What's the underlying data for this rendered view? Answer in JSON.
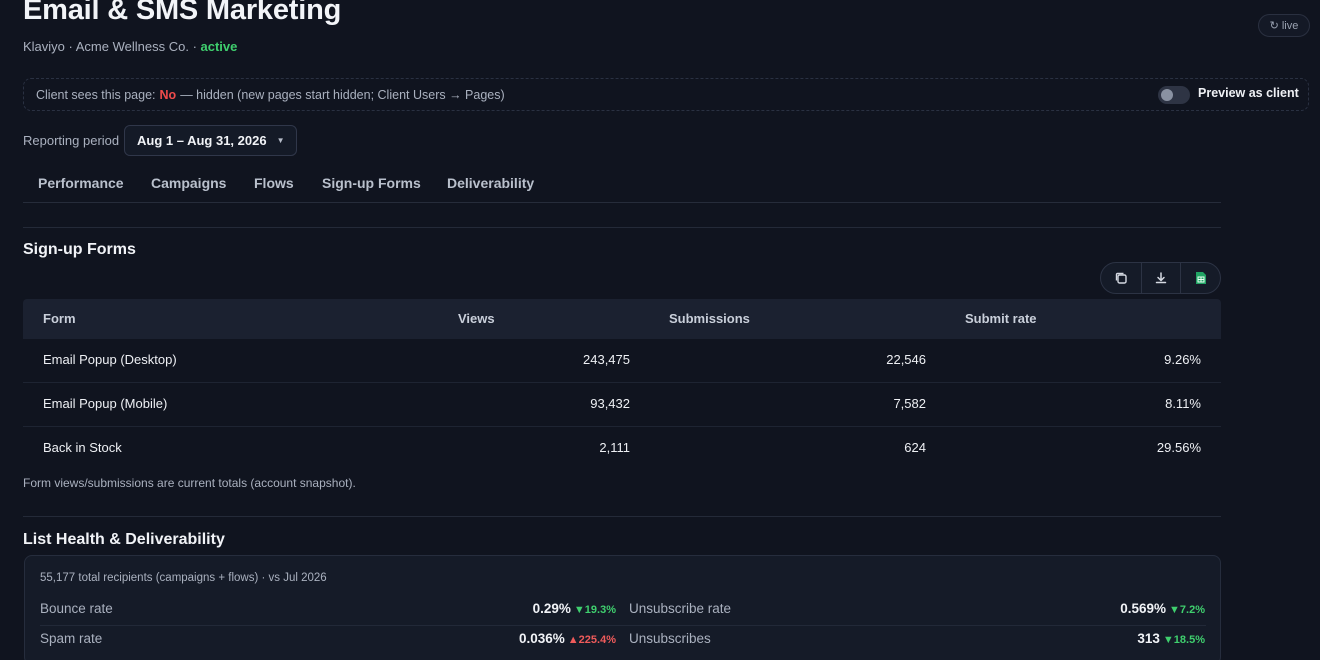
{
  "header": {
    "title": "Email & SMS Marketing",
    "platform": "Klaviyo",
    "client": "Acme Wellness Co.",
    "status": "active",
    "live_label": "live"
  },
  "visibility": {
    "prefix": "Client sees this page:",
    "value": "No",
    "suffix": "— hidden (new pages start hidden; Client Users → Pages)",
    "preview_label": "Preview as client"
  },
  "reporting": {
    "label": "Reporting period",
    "value": "Aug 1 – Aug 31, 2026"
  },
  "tabs": [
    {
      "label": "Performance"
    },
    {
      "label": "Campaigns"
    },
    {
      "label": "Flows"
    },
    {
      "label": "Sign-up Forms"
    },
    {
      "label": "Deliverability"
    }
  ],
  "signup_forms": {
    "title": "Sign-up Forms",
    "columns": [
      "Form",
      "Views",
      "Submissions",
      "Submit rate"
    ],
    "rows": [
      {
        "form": "Email Popup (Desktop)",
        "views": "243,475",
        "submissions": "22,546",
        "rate": "9.26%"
      },
      {
        "form": "Email Popup (Mobile)",
        "views": "93,432",
        "submissions": "7,582",
        "rate": "8.11%"
      },
      {
        "form": "Back in Stock",
        "views": "2,111",
        "submissions": "624",
        "rate": "29.56%"
      }
    ],
    "footnote": "Form views/submissions are current totals (account snapshot).",
    "icons": [
      "copy-icon",
      "download-icon",
      "spreadsheet-icon"
    ]
  },
  "list_health": {
    "title": "List Health & Deliverability",
    "note": "55,177 total recipients (campaigns + flows) · vs Jul 2026",
    "metrics": [
      {
        "label": "Bounce rate",
        "value": "0.29%",
        "delta": "▼19.3%",
        "direction": "down"
      },
      {
        "label": "Unsubscribe rate",
        "value": "0.569%",
        "delta": "▼7.2%",
        "direction": "down"
      },
      {
        "label": "Spam rate",
        "value": "0.036%",
        "delta": "▲225.4%",
        "direction": "up"
      },
      {
        "label": "Unsubscribes",
        "value": "313",
        "delta": "▼18.5%",
        "direction": "down"
      }
    ]
  },
  "colors": {
    "background": "#10141f",
    "active_status": "#3fcf6e",
    "negative": "#f04b4b",
    "positive_delta": "#3fcf6e",
    "negative_delta": "#ef5b5b"
  }
}
